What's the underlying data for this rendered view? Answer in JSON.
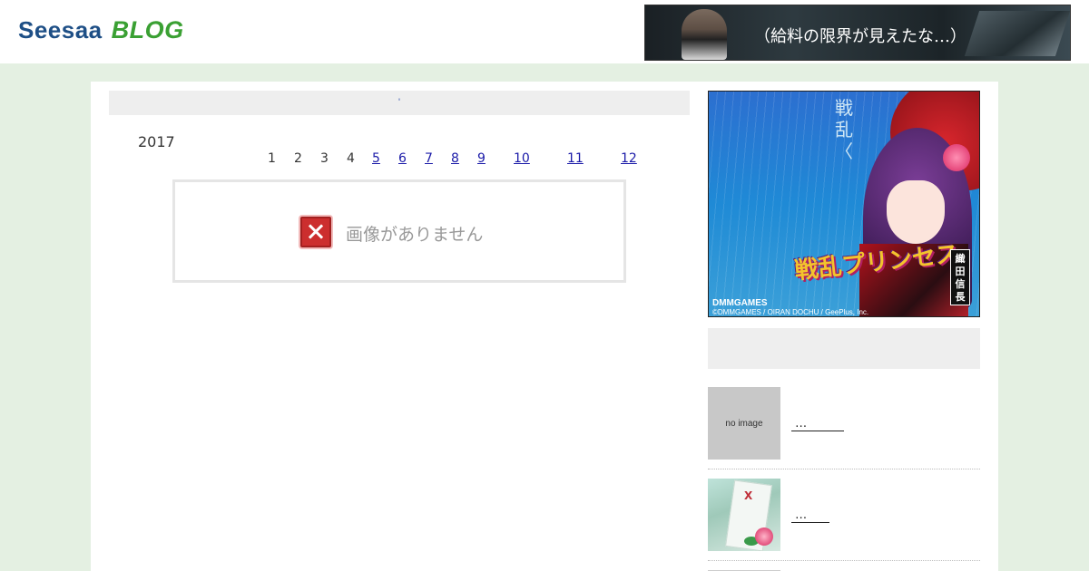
{
  "header": {
    "logo_seesaa": "Seesaa",
    "logo_blog": "BLOG",
    "banner": {
      "text": "（給料の限界が見えたな…）"
    }
  },
  "main": {
    "title_link": "'",
    "archive": {
      "year": "2017",
      "months": [
        {
          "label": "1",
          "linked": false
        },
        {
          "label": "2",
          "linked": false
        },
        {
          "label": "3",
          "linked": false
        },
        {
          "label": "4",
          "linked": false
        },
        {
          "label": "5",
          "linked": true
        },
        {
          "label": "6",
          "linked": true
        },
        {
          "label": "7",
          "linked": true
        },
        {
          "label": "8",
          "linked": true
        },
        {
          "label": "9",
          "linked": true
        },
        {
          "label": "10",
          "linked": true
        },
        {
          "label": "11",
          "linked": true
        },
        {
          "label": "12",
          "linked": true
        }
      ]
    },
    "no_image_text": "画像がありません"
  },
  "sidebar": {
    "ad": {
      "title": "戦乱〈",
      "logo": "戦乱プリンセス",
      "character_name": "織田信長",
      "brand": "DMMGAMES",
      "copyright": "©DMMGAMES / OIRAN DOCHU / GeePlus, Inc."
    },
    "posts": [
      {
        "thumb": "no image",
        "link": " …          "
      },
      {
        "thumb": "",
        "link": " …      "
      }
    ]
  },
  "colors": {
    "page_bg": "#e4f0e2",
    "logo_blue": "#1e4f86",
    "logo_green": "#3aa033",
    "link_blue": "#1a1aa8",
    "bar_grey": "#eeeeee"
  }
}
